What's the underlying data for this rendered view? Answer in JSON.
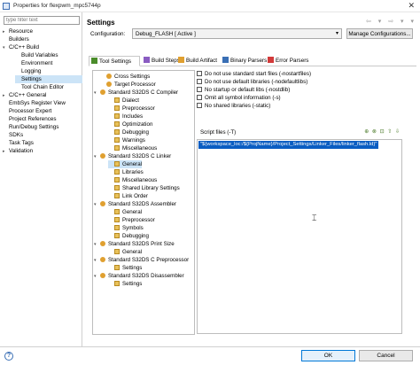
{
  "window": {
    "title": "Properties for flexpwm_mpc5744p",
    "close_glyph": "✕"
  },
  "sidebar": {
    "filter_placeholder": "type filter text",
    "items": [
      {
        "label": "Resource",
        "toggle": "▸"
      },
      {
        "label": "Builders",
        "toggle": ""
      },
      {
        "label": "C/C++ Build",
        "toggle": "▾"
      },
      {
        "label": "Build Variables",
        "toggle": ""
      },
      {
        "label": "Environment",
        "toggle": ""
      },
      {
        "label": "Logging",
        "toggle": ""
      },
      {
        "label": "Settings",
        "toggle": ""
      },
      {
        "label": "Tool Chain Editor",
        "toggle": ""
      },
      {
        "label": "C/C++ General",
        "toggle": "▸"
      },
      {
        "label": "EmbSys Register View",
        "toggle": ""
      },
      {
        "label": "Processor Expert",
        "toggle": ""
      },
      {
        "label": "Project References",
        "toggle": ""
      },
      {
        "label": "Run/Debug Settings",
        "toggle": ""
      },
      {
        "label": "SDKs",
        "toggle": ""
      },
      {
        "label": "Task Tags",
        "toggle": ""
      },
      {
        "label": "Validation",
        "toggle": "▸"
      }
    ],
    "selected": "Settings"
  },
  "header": {
    "title": "Settings",
    "nav_arrows": "⇦ ▾ ⇨ ▾ ▾"
  },
  "configuration": {
    "label": "Configuration:",
    "value": "Debug_FLASH  [ Active ]",
    "caret": "▾",
    "manage_button": "Manage Configurations..."
  },
  "tabs": [
    {
      "label": "Tool Settings",
      "icon_color": "#4a8c2a"
    },
    {
      "label": "Build Steps",
      "icon_color": "#8a5cc2"
    },
    {
      "label": "Build Artifact",
      "icon_color": "#e0a030"
    },
    {
      "label": "Binary Parsers",
      "icon_color": "#3a6fb5"
    },
    {
      "label": "Error Parsers",
      "icon_color": "#d23a3a"
    }
  ],
  "tool_tree": [
    {
      "label": "Cross Settings",
      "level": 1,
      "toggle": ""
    },
    {
      "label": "Target Processor",
      "level": 1,
      "toggle": ""
    },
    {
      "label": "Standard S32DS C Compiler",
      "level": 0,
      "toggle": "▾"
    },
    {
      "label": "Dialect",
      "level": 2,
      "toggle": ""
    },
    {
      "label": "Preprocessor",
      "level": 2,
      "toggle": ""
    },
    {
      "label": "Includes",
      "level": 2,
      "toggle": ""
    },
    {
      "label": "Optimization",
      "level": 2,
      "toggle": ""
    },
    {
      "label": "Debugging",
      "level": 2,
      "toggle": ""
    },
    {
      "label": "Warnings",
      "level": 2,
      "toggle": ""
    },
    {
      "label": "Miscellaneous",
      "level": 2,
      "toggle": ""
    },
    {
      "label": "Standard S32DS C Linker",
      "level": 0,
      "toggle": "▾"
    },
    {
      "label": "General",
      "level": 2,
      "toggle": ""
    },
    {
      "label": "Libraries",
      "level": 2,
      "toggle": ""
    },
    {
      "label": "Miscellaneous",
      "level": 2,
      "toggle": ""
    },
    {
      "label": "Shared Library Settings",
      "level": 2,
      "toggle": ""
    },
    {
      "label": "Link Order",
      "level": 2,
      "toggle": ""
    },
    {
      "label": "Standard S32DS Assembler",
      "level": 0,
      "toggle": "▾"
    },
    {
      "label": "General",
      "level": 2,
      "toggle": ""
    },
    {
      "label": "Preprocessor",
      "level": 2,
      "toggle": ""
    },
    {
      "label": "Symbols",
      "level": 2,
      "toggle": ""
    },
    {
      "label": "Debugging",
      "level": 2,
      "toggle": ""
    },
    {
      "label": "Standard S32DS Print Size",
      "level": 0,
      "toggle": "▾"
    },
    {
      "label": "General",
      "level": 2,
      "toggle": ""
    },
    {
      "label": "Standard S32DS C Preprocessor",
      "level": 0,
      "toggle": "▾"
    },
    {
      "label": "Settings",
      "level": 2,
      "toggle": ""
    },
    {
      "label": "Standard S32DS Disassembler",
      "level": 0,
      "toggle": "▾"
    },
    {
      "label": "Settings",
      "level": 2,
      "toggle": ""
    }
  ],
  "tool_tree_selected": "General",
  "linker_options": [
    {
      "label": "Do not use standard start files (-nostartfiles)",
      "checked": false
    },
    {
      "label": "Do not use default libraries (-nodefaultlibs)",
      "checked": false
    },
    {
      "label": "No startup or default libs (-nostdlib)",
      "checked": false
    },
    {
      "label": "Omit all symbol information (-s)",
      "checked": false
    },
    {
      "label": "No shared libraries (-static)",
      "checked": false
    }
  ],
  "script_files": {
    "label": "Script files (-T)",
    "tool_icons": "⊕ ⊗ ⊡ ⇧ ⇩",
    "entries": [
      "\"${workspace_loc:/${ProjName}/Project_Settings/Linker_Files/linker_flash.ld}\""
    ]
  },
  "footer": {
    "help_glyph": "?",
    "ok_label": "OK",
    "cancel_label": "Cancel"
  }
}
